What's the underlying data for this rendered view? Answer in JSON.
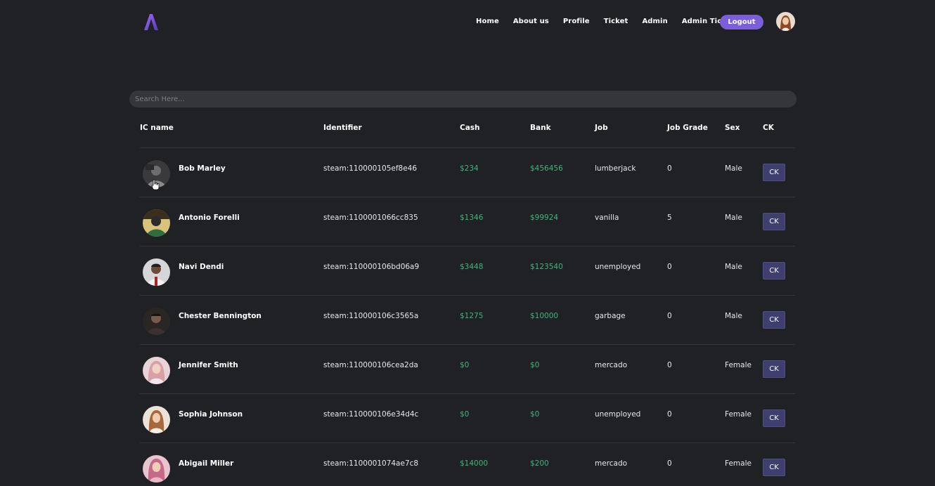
{
  "nav": {
    "items": [
      {
        "label": "Home"
      },
      {
        "label": "About us"
      },
      {
        "label": "Profile"
      },
      {
        "label": "Ticket"
      },
      {
        "label": "Admin"
      },
      {
        "label": "Admin Ticket"
      }
    ],
    "logout_label": "Logout"
  },
  "search": {
    "placeholder": "Search Here..."
  },
  "table": {
    "headers": [
      "IC name",
      "Identifier",
      "Cash",
      "Bank",
      "Job",
      "Job Grade",
      "Sex",
      "CK"
    ],
    "rows": [
      {
        "name": "Bob Marley",
        "identifier": "steam:110000105ef8e46",
        "cash": "$234",
        "bank": "$456456",
        "job": "lumberjack",
        "grade": "0",
        "sex": "Male",
        "ck": "CK"
      },
      {
        "name": "Antonio Forelli",
        "identifier": "steam:1100001066cc835",
        "cash": "$1346",
        "bank": "$99924",
        "job": "vanilla",
        "grade": "5",
        "sex": "Male",
        "ck": "CK"
      },
      {
        "name": "Navi Dendi",
        "identifier": "steam:110000106bd06a9",
        "cash": "$3448",
        "bank": "$123540",
        "job": "unemployed",
        "grade": "0",
        "sex": "Male",
        "ck": "CK"
      },
      {
        "name": "Chester Bennington",
        "identifier": "steam:110000106c3565a",
        "cash": "$1275",
        "bank": "$10000",
        "job": "garbage",
        "grade": "0",
        "sex": "Male",
        "ck": "CK"
      },
      {
        "name": "Jennifer Smith",
        "identifier": "steam:110000106cea2da",
        "cash": "$0",
        "bank": "$0",
        "job": "mercado",
        "grade": "0",
        "sex": "Female",
        "ck": "CK"
      },
      {
        "name": "Sophia Johnson",
        "identifier": "steam:110000106e34d4c",
        "cash": "$0",
        "bank": "$0",
        "job": "unemployed",
        "grade": "0",
        "sex": "Female",
        "ck": "CK"
      },
      {
        "name": "Abigail Miller",
        "identifier": "steam:1100001074ae7c8",
        "cash": "$14000",
        "bank": "$200",
        "job": "mercado",
        "grade": "0",
        "sex": "Female",
        "ck": "CK"
      }
    ]
  },
  "colors": {
    "background": "#202125",
    "accent": "#7b5fd8",
    "money": "#3fb67a",
    "ck_button": "#3e3f6e"
  }
}
